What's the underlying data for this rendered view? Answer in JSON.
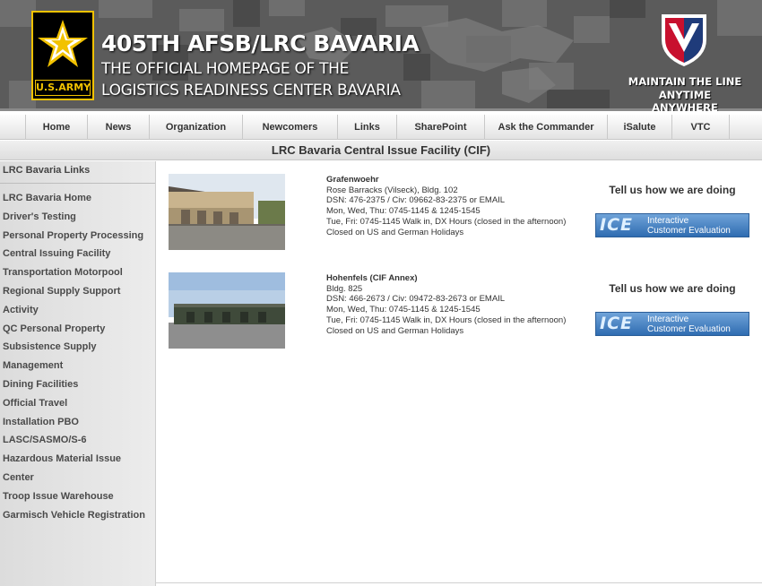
{
  "header": {
    "army_logo_text": "U.S.ARMY",
    "title": "405TH AFSB/LRC BAVARIA",
    "subtitle_line1": "THE OFFICIAL HOMEPAGE OF THE",
    "subtitle_line2": "LOGISTICS READINESS CENTER BAVARIA",
    "tagline_line1": "MAINTAIN THE LINE",
    "tagline_line2": "ANYTIME ANYWHERE"
  },
  "nav": {
    "items": [
      {
        "label": "Home"
      },
      {
        "label": "News"
      },
      {
        "label": "Organization"
      },
      {
        "label": "Newcomers"
      },
      {
        "label": "Links"
      },
      {
        "label": "SharePoint"
      },
      {
        "label": "Ask the Commander"
      },
      {
        "label": "iSalute"
      },
      {
        "label": "VTC"
      }
    ]
  },
  "page": {
    "heading": "LRC Bavaria Central Issue Facility (CIF)"
  },
  "sidebar": {
    "heading": "LRC Bavaria Links",
    "links": [
      {
        "label": "LRC Bavaria Home"
      },
      {
        "label": "Driver's Testing"
      },
      {
        "label": "Personal Property Processing"
      },
      {
        "label": "Central Issuing Facility"
      },
      {
        "label": "Transportation Motorpool"
      },
      {
        "label": "Regional Supply Support"
      },
      {
        "label": "Activity"
      },
      {
        "label": "QC Personal Property"
      },
      {
        "label": "Subsistence Supply"
      },
      {
        "label": "Management"
      },
      {
        "label": "Dining Facilities"
      },
      {
        "label": "Official Travel"
      },
      {
        "label": "Installation PBO"
      },
      {
        "label": "LASC/SASMO/S-6"
      },
      {
        "label": "Hazardous Material Issue"
      },
      {
        "label": "Center"
      },
      {
        "label": "Troop Issue Warehouse"
      },
      {
        "label": "Garmisch Vehicle Registration"
      }
    ]
  },
  "locations": [
    {
      "name": "Grafenwoehr",
      "address": "Rose Barracks (Vilseck), Bldg. 102",
      "phone": "DSN: 476-2375 / Civ: 09662-83-2375 or  EMAIL",
      "hours1": "Mon, Wed, Thu: 0745-1145 & 1245-1545",
      "hours2": "Tue, Fri: 0745-1145 Walk in, DX Hours (closed in the afternoon)",
      "closed": "Closed on US and German Holidays",
      "feedback_label": "Tell us how we are doing",
      "ice_mark": "ICE",
      "ice_line1": "Interactive",
      "ice_line2": "Customer Evaluation"
    },
    {
      "name": "Hohenfels (CIF Annex)",
      "address": "Bldg. 825",
      "phone": "DSN: 466-2673 / Civ: 09472-83-2673 or  EMAIL",
      "hours1": "Mon, Wed, Thu: 0745-1145 & 1245-1545",
      "hours2": "Tue, Fri: 0745-1145 Walk in, DX Hours (closed in the afternoon)",
      "closed": "Closed on US and German Holidays",
      "feedback_label": "Tell us how we are doing",
      "ice_mark": "ICE",
      "ice_line1": "Interactive",
      "ice_line2": "Customer Evaluation"
    }
  ],
  "colors": {
    "army_gold": "#f2c200",
    "banner_gray": "#5a5a5a",
    "ice_blue": "#2f6cb1"
  }
}
